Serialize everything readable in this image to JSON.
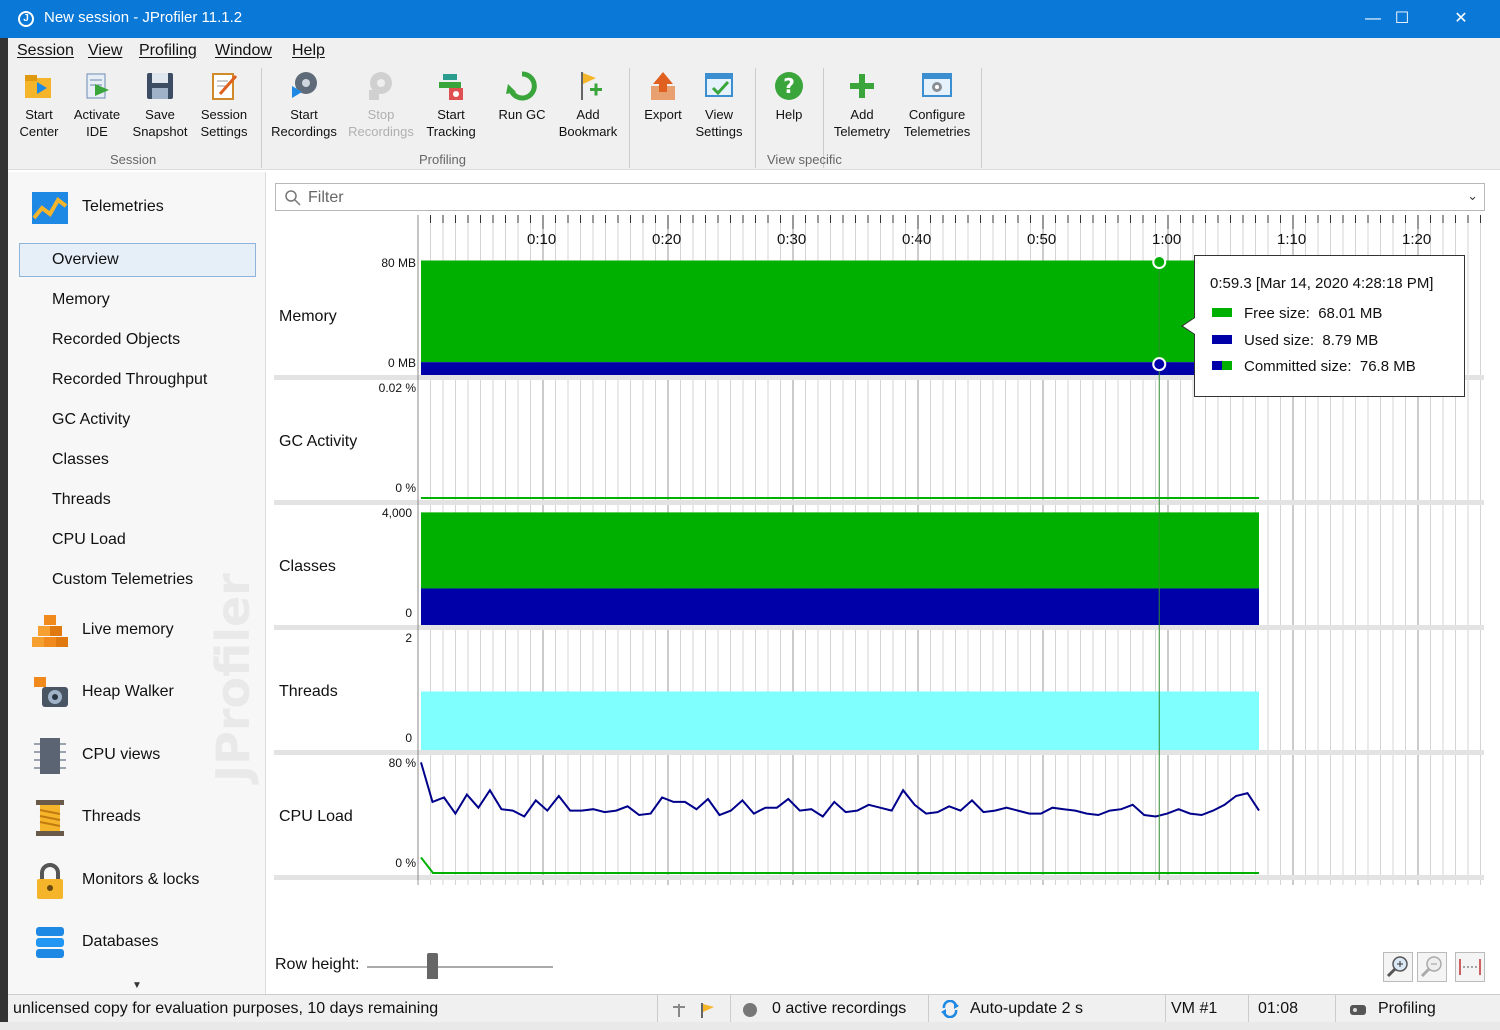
{
  "window": {
    "title": "New session - JProfiler 11.1.2",
    "minimize": "—",
    "maximize": "☐",
    "close": "✕"
  },
  "menu": [
    "Session",
    "View",
    "Profiling",
    "Window",
    "Help"
  ],
  "toolbar": {
    "groups": [
      {
        "label": "Session",
        "buttons": [
          {
            "label1": "Start",
            "label2": "Center",
            "icon": "start-center-icon"
          },
          {
            "label1": "Activate",
            "label2": "IDE",
            "icon": "activate-ide-icon"
          },
          {
            "label1": "Save",
            "label2": "Snapshot",
            "icon": "save-snapshot-icon"
          },
          {
            "label1": "Session",
            "label2": "Settings",
            "icon": "session-settings-icon"
          }
        ]
      },
      {
        "label": "Profiling",
        "buttons": [
          {
            "label1": "Start",
            "label2": "Recordings",
            "icon": "start-recordings-icon"
          },
          {
            "label1": "Stop",
            "label2": "Recordings",
            "icon": "stop-recordings-icon",
            "disabled": true
          },
          {
            "label1": "Start",
            "label2": "Tracking",
            "icon": "start-tracking-icon"
          },
          {
            "label1": "Run GC",
            "label2": "",
            "icon": "run-gc-icon"
          },
          {
            "label1": "Add",
            "label2": "Bookmark",
            "icon": "add-bookmark-icon"
          }
        ]
      },
      {
        "label": "View specific",
        "buttons": [
          {
            "label1": "Export",
            "label2": "",
            "icon": "export-icon"
          },
          {
            "label1": "View",
            "label2": "Settings",
            "icon": "view-settings-icon"
          },
          {
            "label1": "Help",
            "label2": "",
            "icon": "help-icon"
          },
          {
            "label1": "Add",
            "label2": "Telemetry",
            "icon": "add-telemetry-icon"
          },
          {
            "label1": "Configure",
            "label2": "Telemetries",
            "icon": "configure-telemetries-icon"
          }
        ]
      }
    ]
  },
  "sidebar": {
    "telemetries_label": "Telemetries",
    "items": [
      "Overview",
      "Memory",
      "Recorded Objects",
      "Recorded Throughput",
      "GC Activity",
      "Classes",
      "Threads",
      "CPU Load",
      "Custom Telemetries"
    ],
    "active_item": "Overview",
    "sections": [
      "Live memory",
      "Heap Walker",
      "CPU views",
      "Threads",
      "Monitors & locks",
      "Databases"
    ],
    "watermark": "JProfiler"
  },
  "filter": {
    "placeholder": "Filter"
  },
  "timeline": {
    "labels": [
      "0:10",
      "0:20",
      "0:30",
      "0:40",
      "0:50",
      "1:00",
      "1:10",
      "1:20"
    ]
  },
  "chart_data": [
    {
      "type": "area",
      "title": "Memory",
      "ylim_labels": [
        "80 MB",
        "0 MB"
      ],
      "series": [
        {
          "name": "Free size",
          "value": 68.01,
          "unit": "MB",
          "color": "#00b000"
        },
        {
          "name": "Used size",
          "value": 8.79,
          "unit": "MB",
          "color": "#0000a8"
        }
      ],
      "committed": 76.8
    },
    {
      "type": "line",
      "title": "GC Activity",
      "ylim_labels": [
        "0.02 %",
        "0 %"
      ],
      "values": [
        0
      ]
    },
    {
      "type": "area",
      "title": "Classes",
      "ylim_labels": [
        "4,000",
        "0"
      ],
      "series": [
        {
          "name": "total",
          "value": 3850,
          "color": "#00b000"
        },
        {
          "name": "filtered",
          "value": 1250,
          "color": "#0000a8"
        }
      ]
    },
    {
      "type": "area",
      "title": "Threads",
      "ylim_labels": [
        "2",
        "0"
      ],
      "series": [
        {
          "name": "threads",
          "value": 1,
          "color": "#80ffff"
        }
      ]
    },
    {
      "type": "line",
      "title": "CPU Load",
      "ylim_labels": [
        "80 %",
        "0 %"
      ],
      "ylim": [
        0,
        80
      ],
      "series": [
        {
          "name": "process",
          "color": "#00008b",
          "values": [
            77,
            50,
            53,
            42,
            55,
            46,
            58,
            45,
            44,
            40,
            51,
            44,
            54,
            44,
            44,
            45,
            43,
            44,
            47,
            41,
            42,
            53,
            50,
            50,
            45,
            52,
            41,
            44,
            51,
            42,
            46,
            46,
            52,
            44,
            45,
            40,
            50,
            43,
            44,
            48,
            46,
            44,
            58,
            48,
            42,
            43,
            47,
            44,
            51,
            43,
            44,
            46,
            44,
            42,
            42,
            46,
            45,
            44,
            42,
            41,
            44,
            45,
            48,
            41,
            40,
            42,
            45,
            42,
            41,
            44,
            48,
            54,
            56,
            44
          ]
        },
        {
          "name": "gc",
          "color": "#00b000",
          "values": [
            12,
            0
          ]
        }
      ]
    }
  ],
  "tooltip": {
    "header": "0:59.3 [Mar 14, 2020 4:28:18 PM]",
    "rows": [
      {
        "label": "Free size:",
        "value": "68.01 MB"
      },
      {
        "label": "Used size:",
        "value": "8.79 MB"
      },
      {
        "label": "Committed size:",
        "value": "76.8 MB"
      }
    ]
  },
  "row_height_label": "Row height:",
  "row_height_value": 0.35,
  "statusbar": {
    "license": "unlicensed copy for evaluation purposes, 10 days remaining",
    "recordings": "0 active recordings",
    "autoupdate": "Auto-update 2 s",
    "vm": "VM #1",
    "time": "01:08",
    "mode": "Profiling"
  }
}
